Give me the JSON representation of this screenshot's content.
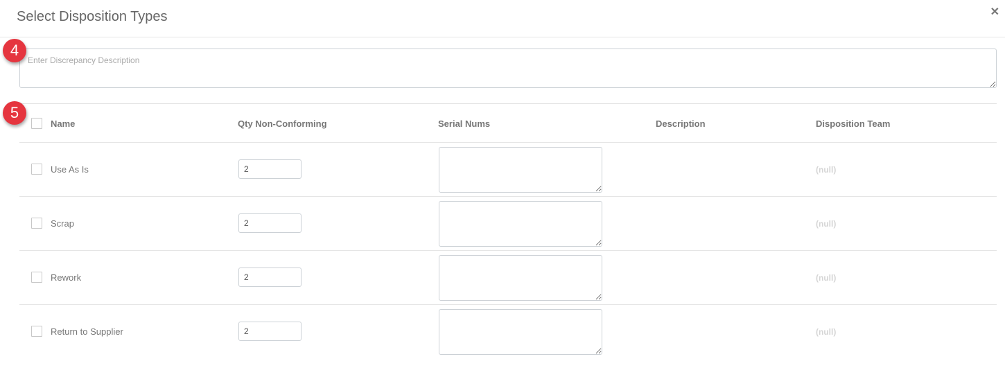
{
  "dialog": {
    "title": "Select Disposition Types",
    "close_icon": "close-icon",
    "close_glyph": "✕"
  },
  "discrepancy": {
    "placeholder": "Enter Discrepancy Description",
    "value": ""
  },
  "annotations": {
    "badge_4": "4",
    "badge_5": "5",
    "color": "#e5353f"
  },
  "table": {
    "columns": {
      "name": "Name",
      "qty": "Qty Non-Conforming",
      "serial": "Serial Nums",
      "description": "Description",
      "team": "Disposition Team"
    },
    "select_all_checked": false,
    "rows": [
      {
        "name": "Use As Is",
        "checked": false,
        "qty": "2",
        "serial": "",
        "description": "",
        "team": "(null)"
      },
      {
        "name": "Scrap",
        "checked": false,
        "qty": "2",
        "serial": "",
        "description": "",
        "team": "(null)"
      },
      {
        "name": "Rework",
        "checked": false,
        "qty": "2",
        "serial": "",
        "description": "",
        "team": "(null)"
      },
      {
        "name": "Return to Supplier",
        "checked": false,
        "qty": "2",
        "serial": "",
        "description": "",
        "team": "(null)"
      }
    ]
  }
}
